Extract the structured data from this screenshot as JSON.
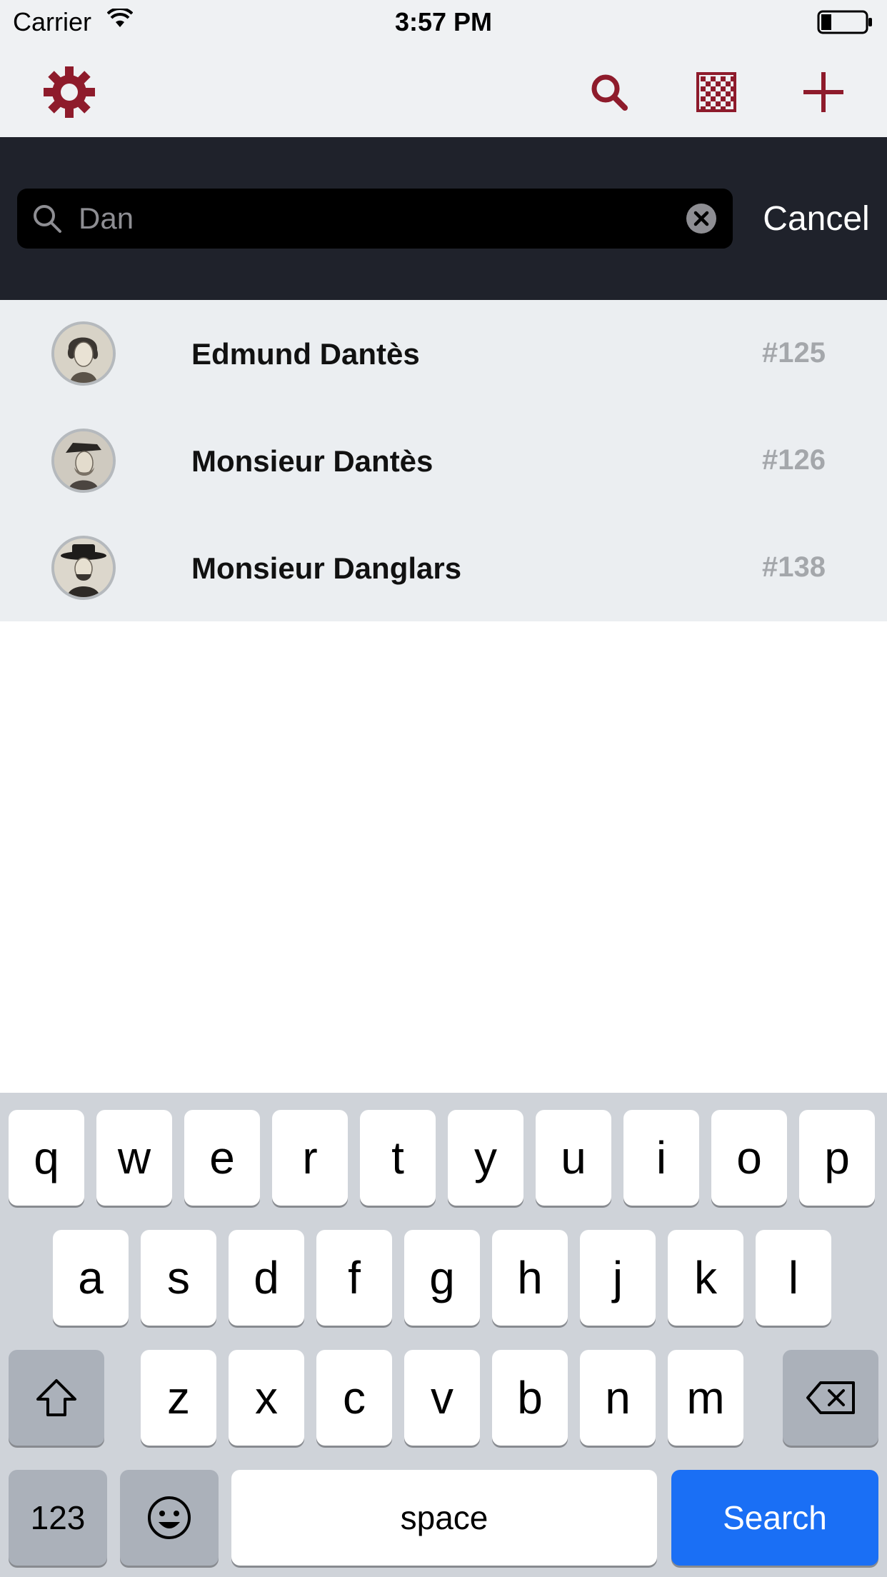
{
  "status_bar": {
    "carrier": "Carrier",
    "time": "3:57 PM"
  },
  "toolbar": {
    "icons": {
      "settings": "gear-icon",
      "search": "search-icon",
      "grid": "checkerboard-icon",
      "add": "plus-icon"
    },
    "accent_color": "#8e1b2b"
  },
  "search": {
    "query": "Dan",
    "cancel_label": "Cancel"
  },
  "results": [
    {
      "name": "Edmund Dantès",
      "number": "#125"
    },
    {
      "name": "Monsieur Dantès",
      "number": "#126"
    },
    {
      "name": "Monsieur Danglars",
      "number": "#138"
    }
  ],
  "keyboard": {
    "row1": [
      "q",
      "w",
      "e",
      "r",
      "t",
      "y",
      "u",
      "i",
      "o",
      "p"
    ],
    "row2": [
      "a",
      "s",
      "d",
      "f",
      "g",
      "h",
      "j",
      "k",
      "l"
    ],
    "row3": [
      "z",
      "x",
      "c",
      "v",
      "b",
      "n",
      "m"
    ],
    "numbers_label": "123",
    "space_label": "space",
    "search_label": "Search",
    "search_key_color": "#1a6ff5"
  }
}
